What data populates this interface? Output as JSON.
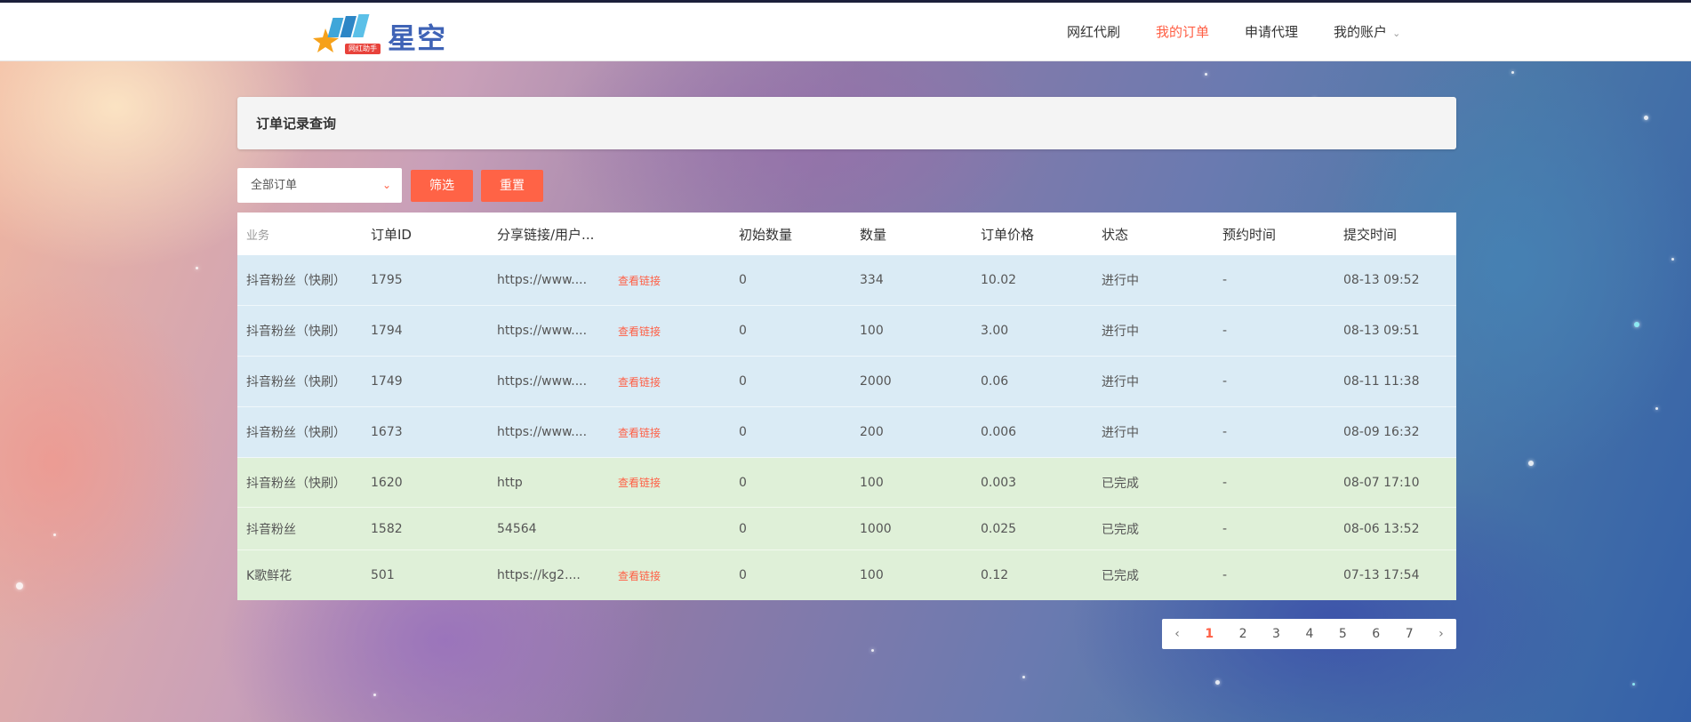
{
  "header": {
    "logo_text": "星空",
    "logo_tag": "网红助手",
    "nav": [
      {
        "label": "网红代刷",
        "active": false
      },
      {
        "label": "我的订单",
        "active": true
      },
      {
        "label": "申请代理",
        "active": false
      },
      {
        "label": "我的账户",
        "active": false,
        "has_dropdown": true
      }
    ]
  },
  "page": {
    "title": "订单记录查询"
  },
  "filters": {
    "select_value": "全部订单",
    "filter_button": "筛选",
    "reset_button": "重置"
  },
  "table": {
    "columns": [
      "业务",
      "订单ID",
      "分享链接/用户...",
      "",
      "初始数量",
      "数量",
      "订单价格",
      "状态",
      "预约时间",
      "提交时间"
    ],
    "rows": [
      {
        "service": "抖音粉丝（快刷）",
        "id": "1795",
        "share": "https://www....",
        "link": "查看链接",
        "initial": "0",
        "qty": "334",
        "price": "10.02",
        "status": "进行中",
        "reserve": "-",
        "submitted": "08-13 09:52",
        "tone": "blue"
      },
      {
        "service": "抖音粉丝（快刷）",
        "id": "1794",
        "share": "https://www....",
        "link": "查看链接",
        "initial": "0",
        "qty": "100",
        "price": "3.00",
        "status": "进行中",
        "reserve": "-",
        "submitted": "08-13 09:51",
        "tone": "blue"
      },
      {
        "service": "抖音粉丝（快刷）",
        "id": "1749",
        "share": "https://www....",
        "link": "查看链接",
        "initial": "0",
        "qty": "2000",
        "price": "0.06",
        "status": "进行中",
        "reserve": "-",
        "submitted": "08-11 11:38",
        "tone": "blue"
      },
      {
        "service": "抖音粉丝（快刷）",
        "id": "1673",
        "share": "https://www....",
        "link": "查看链接",
        "initial": "0",
        "qty": "200",
        "price": "0.006",
        "status": "进行中",
        "reserve": "-",
        "submitted": "08-09 16:32",
        "tone": "blue"
      },
      {
        "service": "抖音粉丝（快刷）",
        "id": "1620",
        "share": "http",
        "link": "查看链接",
        "initial": "0",
        "qty": "100",
        "price": "0.003",
        "status": "已完成",
        "reserve": "-",
        "submitted": "08-07 17:10",
        "tone": "green"
      },
      {
        "service": "抖音粉丝",
        "id": "1582",
        "share": "54564",
        "link": "",
        "initial": "0",
        "qty": "1000",
        "price": "0.025",
        "status": "已完成",
        "reserve": "-",
        "submitted": "08-06 13:52",
        "tone": "green"
      },
      {
        "service": "K歌鲜花",
        "id": "501",
        "share": "https://kg2....",
        "link": "查看链接",
        "initial": "0",
        "qty": "100",
        "price": "0.12",
        "status": "已完成",
        "reserve": "-",
        "submitted": "07-13 17:54",
        "tone": "green"
      }
    ]
  },
  "pagination": {
    "pages": [
      "1",
      "2",
      "3",
      "4",
      "5",
      "6",
      "7"
    ],
    "current": "1",
    "prev_icon": "chevron-left-icon",
    "next_icon": "chevron-right-icon"
  },
  "colors": {
    "accent": "#ff5f45",
    "row_in_progress": "#daebf5",
    "row_done": "#dff0d8"
  }
}
